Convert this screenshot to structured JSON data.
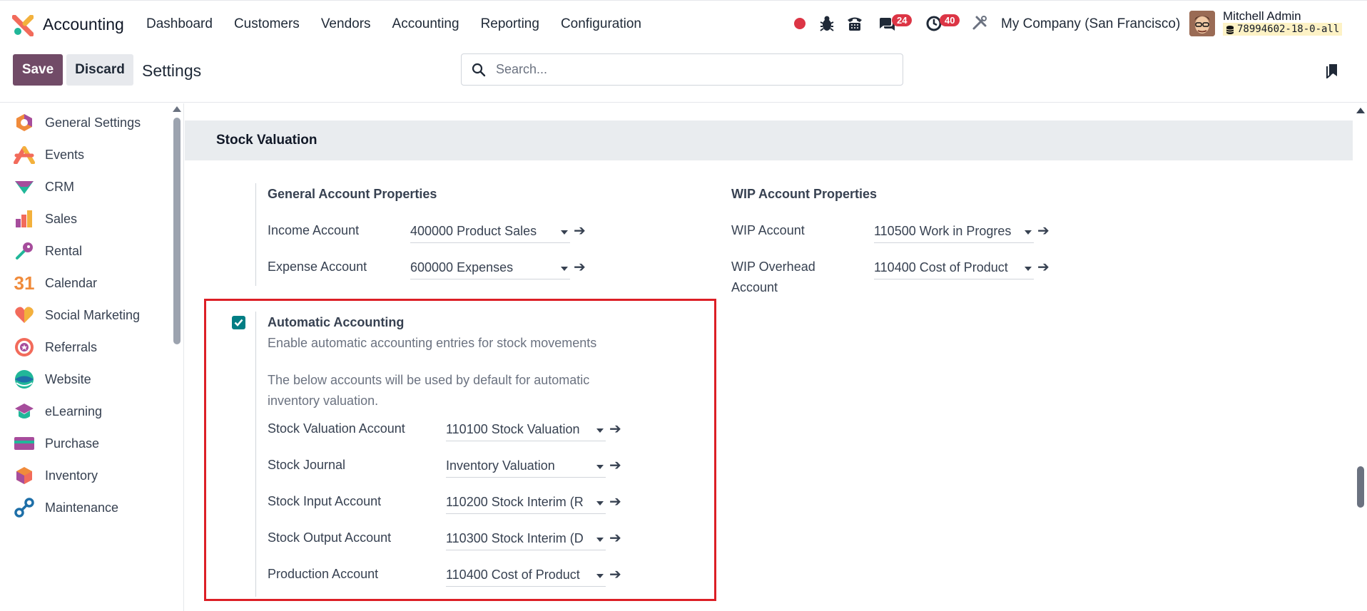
{
  "topbar": {
    "app_name": "Accounting",
    "menu": [
      "Dashboard",
      "Customers",
      "Vendors",
      "Accounting",
      "Reporting",
      "Configuration"
    ],
    "messages_count": "24",
    "activities_count": "40",
    "company": "My Company (San Francisco)",
    "user_name": "Mitchell Admin",
    "db_name": "78994602-18-0-all",
    "recording_color": "#dc3545"
  },
  "control": {
    "save_label": "Save",
    "discard_label": "Discard",
    "breadcrumb": "Settings",
    "search_placeholder": "Search..."
  },
  "sidebar": {
    "items": [
      {
        "label": "General Settings",
        "icon": "general-settings-icon"
      },
      {
        "label": "Events",
        "icon": "events-icon"
      },
      {
        "label": "CRM",
        "icon": "crm-icon"
      },
      {
        "label": "Sales",
        "icon": "sales-icon"
      },
      {
        "label": "Rental",
        "icon": "rental-icon"
      },
      {
        "label": "Calendar",
        "icon": "calendar-icon"
      },
      {
        "label": "Social Marketing",
        "icon": "social-marketing-icon"
      },
      {
        "label": "Referrals",
        "icon": "referrals-icon"
      },
      {
        "label": "Website",
        "icon": "website-icon"
      },
      {
        "label": "eLearning",
        "icon": "elearning-icon"
      },
      {
        "label": "Purchase",
        "icon": "purchase-icon"
      },
      {
        "label": "Inventory",
        "icon": "inventory-icon"
      },
      {
        "label": "Maintenance",
        "icon": "maintenance-icon"
      }
    ],
    "calendar_number": "31"
  },
  "section": {
    "title": "Stock Valuation",
    "general": {
      "title": "General Account Properties",
      "income_label": "Income Account",
      "income_value": "400000 Product Sales",
      "expense_label": "Expense Account",
      "expense_value": "600000 Expenses"
    },
    "wip": {
      "title": "WIP Account Properties",
      "wip_label": "WIP Account",
      "wip_value": "110500 Work in Progres",
      "overhead_label_1": "WIP Overhead",
      "overhead_label_2": "Account",
      "overhead_value": "110400 Cost of Product"
    },
    "auto": {
      "checked": true,
      "title": "Automatic Accounting",
      "subtitle": "Enable automatic accounting entries for stock movements",
      "note_1": "The below accounts will be used by default for automatic",
      "note_2": "inventory valuation.",
      "fields": [
        {
          "label": "Stock Valuation Account",
          "value": "110100 Stock Valuation"
        },
        {
          "label": "Stock Journal",
          "value": "Inventory Valuation"
        },
        {
          "label": "Stock Input Account",
          "value": "110200 Stock Interim (R"
        },
        {
          "label": "Stock Output Account",
          "value": "110300 Stock Interim (D"
        },
        {
          "label": "Production Account",
          "value": "110400 Cost of Product"
        }
      ]
    }
  },
  "colors": {
    "primary": "#714B67",
    "checkbox": "#017e84",
    "highlight": "#dc1f26"
  }
}
